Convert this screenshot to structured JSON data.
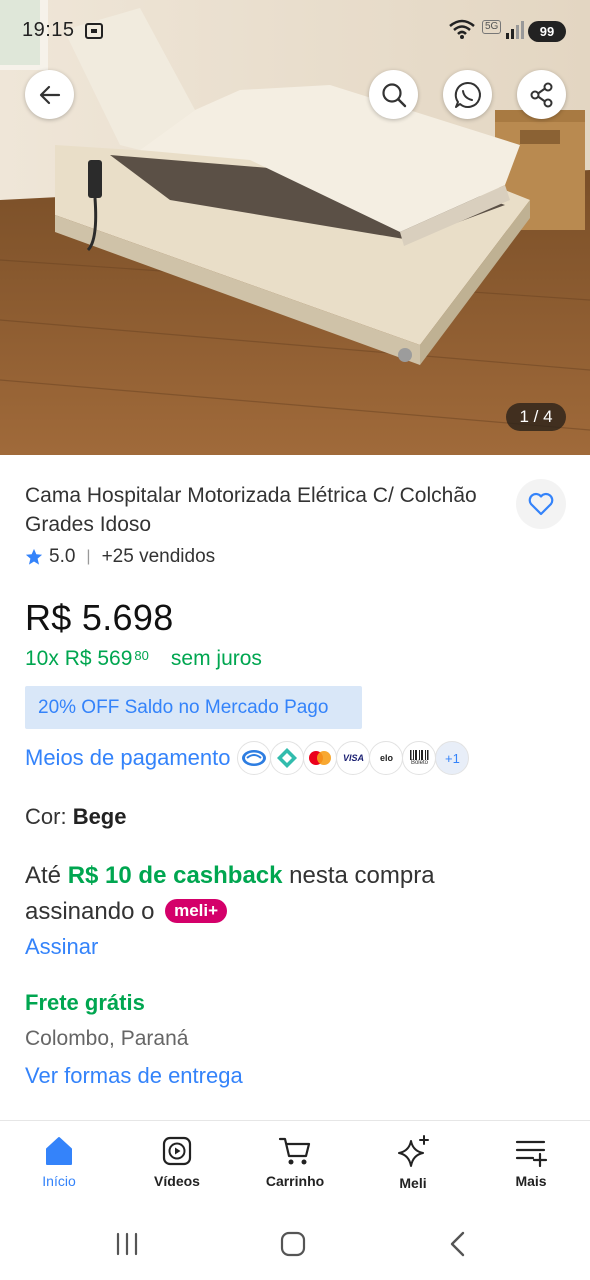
{
  "status_bar": {
    "time": "19:15",
    "network_badge": "5G",
    "battery": "99"
  },
  "gallery": {
    "pager": "1 / 4"
  },
  "product": {
    "title": "Cama Hospitalar Motorizada Elétrica C/ Colchão Grades Idoso",
    "rating": "5.0",
    "sold": "+25 vendidos",
    "price": "R$ 5.698",
    "installments": {
      "prefix": "10x R$ 569",
      "cents": "80",
      "note": "sem juros"
    },
    "promo": "20% OFF Saldo no Mercado Pago",
    "payment_label": "Meios de pagamento",
    "payment_methods": [
      "mercado-pago",
      "pix",
      "mastercard",
      "VISA",
      "elo",
      "Boleto"
    ],
    "payment_more": "+1",
    "color_label": "Cor:",
    "color_value": "Bege",
    "cashback": {
      "pre": "Até",
      "highlight": "R$ 10 de cashback",
      "post": "nesta compra assinando o",
      "badge": "meli+"
    },
    "subscribe_link": "Assinar",
    "shipping": "Frete grátis",
    "location": "Colombo, Paraná",
    "delivery_link": "Ver formas de entrega"
  },
  "bottom_nav": [
    {
      "label": "Início",
      "icon": "home-icon",
      "active": true
    },
    {
      "label": "Vídeos",
      "icon": "video-icon",
      "active": false
    },
    {
      "label": "Carrinho",
      "icon": "cart-icon",
      "active": false
    },
    {
      "label": "Meli",
      "icon": "sparkle-icon",
      "active": false
    },
    {
      "label": "Mais",
      "icon": "menu-plus-icon",
      "active": false
    }
  ],
  "colors": {
    "accent": "#3483fa",
    "green": "#00a650",
    "meli_badge": "#d4006a"
  }
}
